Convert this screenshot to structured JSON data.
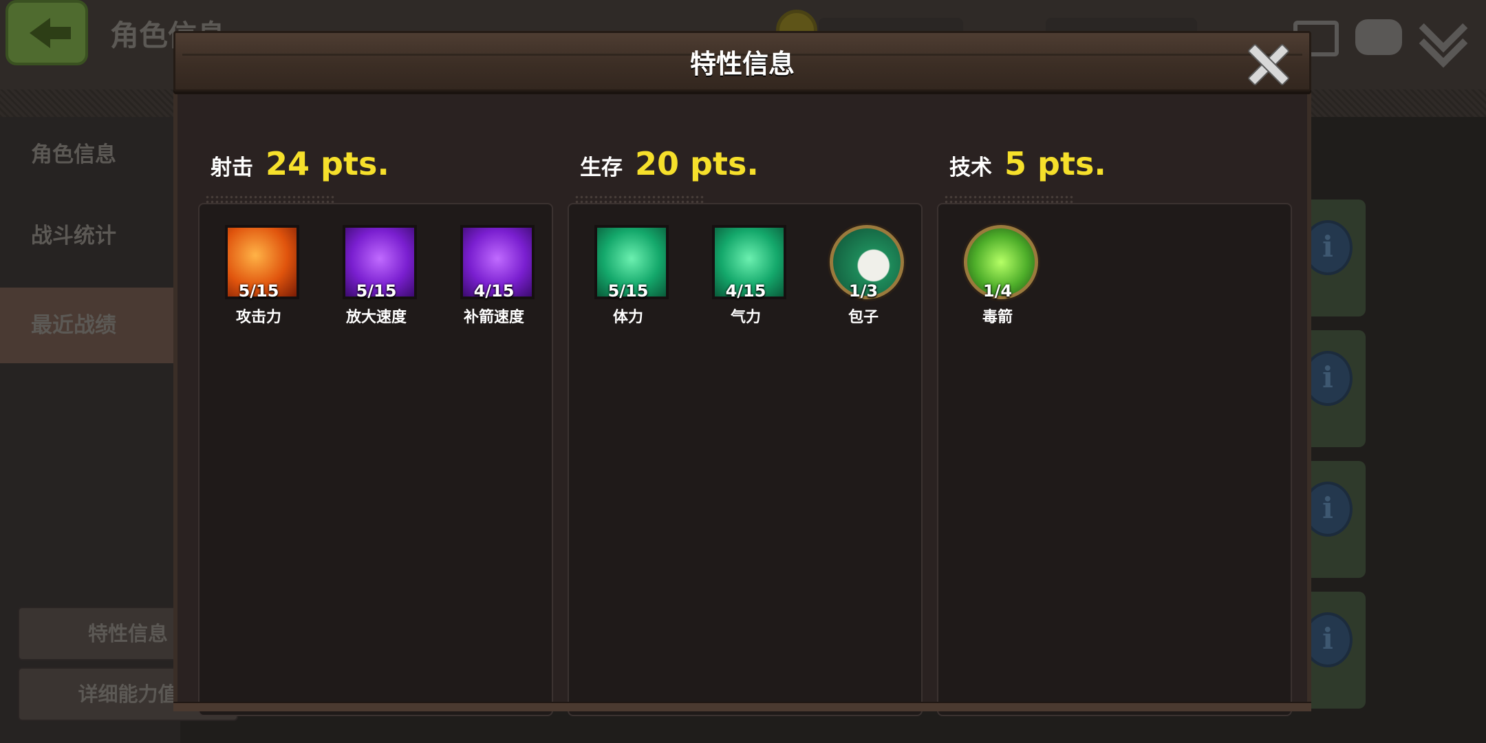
{
  "background": {
    "page_title": "角色信息",
    "sidebar": {
      "items": [
        "角色信息",
        "战斗统计",
        "最近战绩"
      ],
      "active_index": 2,
      "buttons": [
        "特性信息",
        "详细能力值"
      ]
    },
    "info_buttons": [
      "i",
      "i",
      "i",
      "i"
    ]
  },
  "dialog": {
    "title": "特性信息",
    "categories": [
      {
        "name": "射击",
        "points": "24 pts.",
        "skills": [
          {
            "name": "攻击力",
            "level": "5/15",
            "icon": "arrow-attack-icon",
            "color": "#e0540d"
          },
          {
            "name": "放大速度",
            "level": "5/15",
            "icon": "crosshair-icon",
            "color": "#7a1fd0"
          },
          {
            "name": "补箭速度",
            "level": "4/15",
            "icon": "flame-clock-icon",
            "color": "#7a1fd0"
          }
        ]
      },
      {
        "name": "生存",
        "points": "20 pts.",
        "skills": [
          {
            "name": "体力",
            "level": "5/15",
            "icon": "health-cross-icon",
            "color": "#14a86b"
          },
          {
            "name": "气力",
            "level": "4/15",
            "icon": "body-strength-icon",
            "color": "#14a86b"
          },
          {
            "name": "包子",
            "level": "1/3",
            "icon": "bun-icon",
            "color": "#1e8a5a"
          }
        ]
      },
      {
        "name": "技术",
        "points": "5 pts.",
        "skills": [
          {
            "name": "毒箭",
            "level": "1/4",
            "icon": "poison-bubbles-icon",
            "color": "#4eae2a"
          }
        ]
      }
    ]
  }
}
